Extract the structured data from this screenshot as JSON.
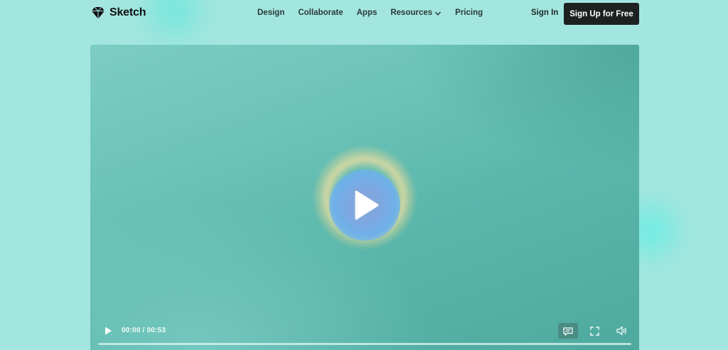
{
  "brand": {
    "name": "Sketch",
    "icon": "diamond-icon"
  },
  "nav": {
    "items": [
      {
        "label": "Design"
      },
      {
        "label": "Collaborate"
      },
      {
        "label": "Apps"
      },
      {
        "label": "Resources",
        "has_dropdown": true
      },
      {
        "label": "Pricing"
      }
    ]
  },
  "auth": {
    "signin_label": "Sign In",
    "signup_label": "Sign Up for Free"
  },
  "video": {
    "time_display": "00:00 / 00:53",
    "progress": 0,
    "icons": {
      "big_play": "play-icon",
      "play": "play-icon",
      "captions": "captions-icon",
      "fullscreen": "fullscreen-icon",
      "volume": "volume-icon"
    }
  },
  "colors": {
    "page_background": "#a3e6df",
    "signup_button": "#1d2221",
    "video_teal": "#5cb8ad"
  }
}
